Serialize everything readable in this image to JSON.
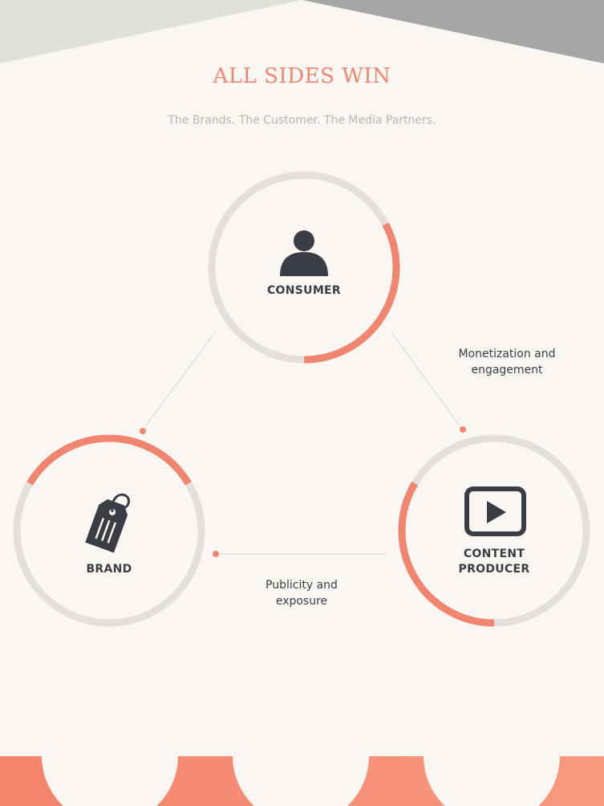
{
  "header": {
    "title": "ALL SIDES WIN",
    "subtitle": "The Brands. The Customer. The Media Partners."
  },
  "nodes": {
    "consumer": {
      "label": "CONSUMER",
      "icon": "person-icon"
    },
    "brand": {
      "label": "BRAND",
      "icon": "price-tag-icon"
    },
    "content_producer": {
      "line1": "CONTENT",
      "line2": "PRODUCER",
      "icon": "play-button-icon"
    }
  },
  "edges": {
    "consumer_to_producer": {
      "line1": "Monetization and",
      "line2": "engagement"
    },
    "brand_to_producer": {
      "line1": "Publicity and",
      "line2": "exposure"
    }
  },
  "colors": {
    "accent": "#f08670",
    "ring": "#e3dfdb",
    "icon": "#3a3e44",
    "background": "#faf7f2",
    "subtitle": "#b8b4b0"
  }
}
